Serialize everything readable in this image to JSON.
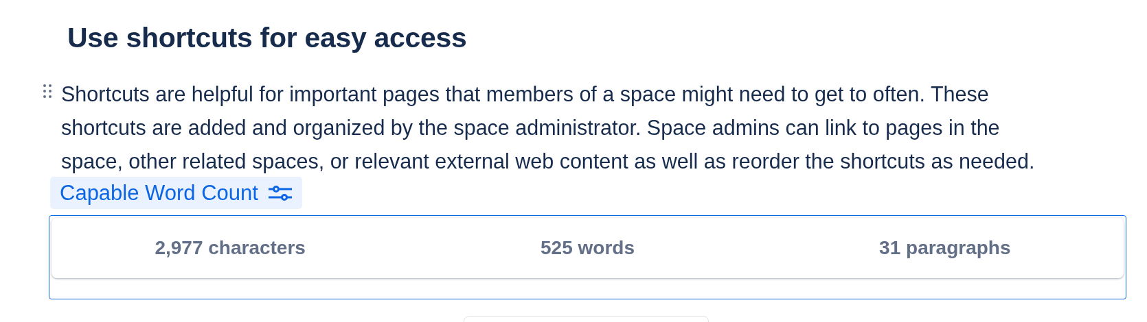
{
  "heading": "Use shortcuts for easy access",
  "paragraph": "Shortcuts are helpful for important pages that members of a space might need to get to often. These shortcuts are added and organized by the space administrator. Space admins can link to pages in the space, other related spaces, or relevant external web content as well as reorder the shortcuts as needed.",
  "word_count": {
    "label": "Capable Word Count",
    "stats": [
      "2,977 characters",
      "525 words",
      "31 paragraphs"
    ]
  }
}
